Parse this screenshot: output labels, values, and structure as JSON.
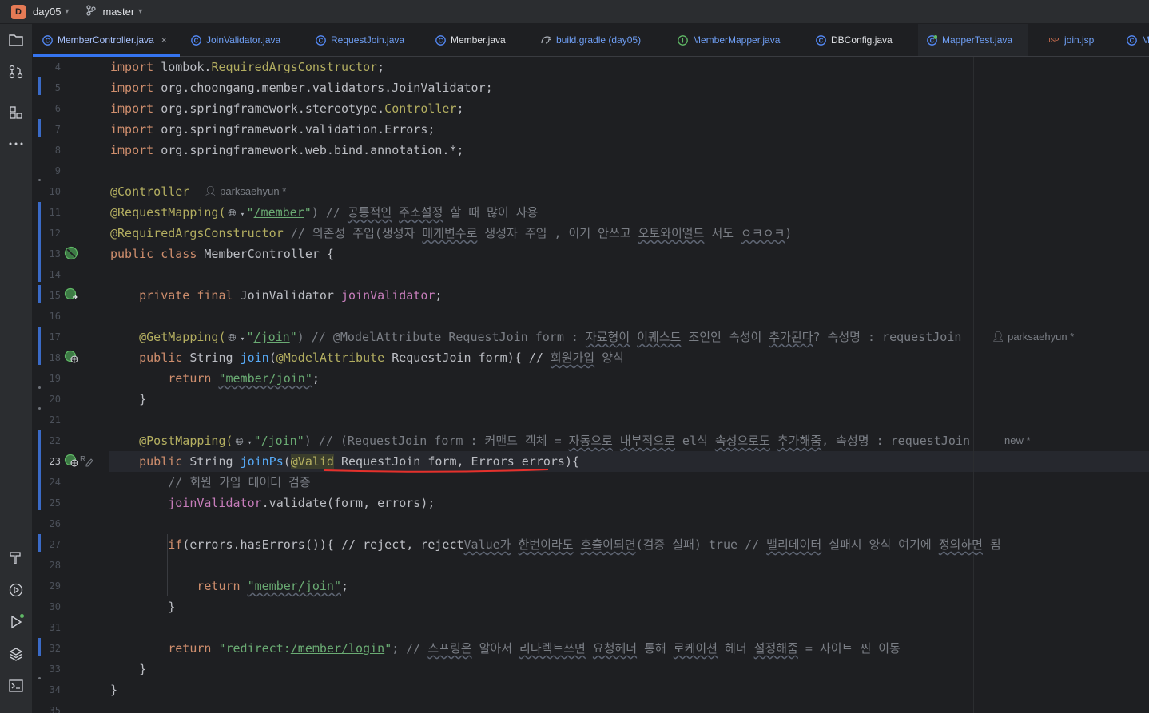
{
  "titlebar": {
    "project_badge": "D",
    "project_name": "day05",
    "branch": "master"
  },
  "toolstrip": {
    "top_tools": [
      "folder-icon",
      "git-commit-icon",
      "structure-icon",
      "more-icon"
    ],
    "bottom_tools": [
      "build-hammer-icon",
      "services-icon",
      "run-icon",
      "layers-icon",
      "terminal-icon"
    ]
  },
  "tabs": [
    {
      "label": "MemberController.java",
      "icon": "class-icon",
      "active": true,
      "close": "×"
    },
    {
      "label": "JoinValidator.java",
      "icon": "class-icon"
    },
    {
      "label": "RequestJoin.java",
      "icon": "class-icon"
    },
    {
      "label": "Member.java",
      "icon": "class-icon"
    },
    {
      "label": "build.gradle (day05)",
      "icon": "gradle-icon"
    },
    {
      "label": "MemberMapper.java",
      "icon": "interface-icon"
    },
    {
      "label": "DBConfig.java",
      "icon": "class-icon"
    },
    {
      "label": "MapperTest.java",
      "icon": "test-class-icon"
    },
    {
      "label": "join.jsp",
      "icon": "jsp-icon"
    },
    {
      "label": "M",
      "icon": "class-icon"
    }
  ],
  "editor": {
    "line_numbers": [
      "4",
      "5",
      "6",
      "7",
      "8",
      "9",
      "10",
      "11",
      "12",
      "13",
      "14",
      "15",
      "16",
      "17",
      "18",
      "19",
      "20",
      "21",
      "22",
      "23",
      "24",
      "25",
      "26",
      "27",
      "28",
      "29",
      "30",
      "31",
      "32",
      "33",
      "34",
      "35"
    ],
    "current_line": "23",
    "authors": {
      "line10": "parksaehyun *",
      "line17": "parksaehyun *",
      "line22": "new *"
    },
    "lines": {
      "l4": [
        "import",
        " lombok.",
        "RequiredArgsConstructor",
        ";"
      ],
      "l5": [
        "import",
        " org.choongang.member.validators.JoinValidator;"
      ],
      "l6": [
        "import",
        " org.springframework.stereotype.",
        "Controller",
        ";"
      ],
      "l7": [
        "import",
        " org.springframework.validation.Errors;"
      ],
      "l8": [
        "import",
        " org.springframework.web.bind.annotation.*;"
      ],
      "l10": [
        "@Controller"
      ],
      "l11": [
        "@RequestMapping(",
        "\"",
        "/member",
        "\"",
        ") // ",
        "공통적인",
        " ",
        "주소설정",
        " 할 때 많이 사용"
      ],
      "l12": [
        "@RequiredArgsConstructor",
        " // 의존성 주입(생성자 ",
        "매개변수로",
        " 생성자 주입 , 이거 안쓰고 ",
        "오토와이얼드",
        " 서도 ",
        "ㅇㅋㅇㅋ",
        ")"
      ],
      "l13": [
        "public class",
        " MemberController {"
      ],
      "l15": [
        "private final",
        " JoinValidator ",
        "joinValidator",
        ";"
      ],
      "l17": [
        "@GetMapping(",
        "\"",
        "/join",
        "\"",
        ") // @ModelAttribute RequestJoin form : ",
        "자료형이",
        " ",
        "이퀘스트",
        " 조인인 속성이 ",
        "추가된다",
        "? 속성명 : requestJoin"
      ],
      "l18": [
        "public",
        " String ",
        "join",
        "(",
        "@ModelAttribute",
        " RequestJoin form){ // ",
        "회원가입",
        " 양식"
      ],
      "l19": [
        "return",
        " ",
        "\"member/join\"",
        ";"
      ],
      "l20": [
        "}"
      ],
      "l22": [
        "@PostMapping(",
        "\"",
        "/join",
        "\"",
        ") // (RequestJoin form : 커맨드 객체 = ",
        "자동으로",
        " ",
        "내부적으로",
        " el식 ",
        "속성으로도",
        " ",
        "추가해줌",
        ", 속성명 : requestJoin"
      ],
      "l23": [
        "public",
        " String ",
        "joinPs",
        "(",
        "@Valid",
        " RequestJoin form, Errors errors){"
      ],
      "l24": [
        "// 회원 가입 데이터 검증"
      ],
      "l25": [
        "joinValidator",
        ".validate(form, errors);"
      ],
      "l27": [
        "if",
        "(errors.hasErrors()){ // reject, reject",
        "Value가",
        " ",
        "한번이라도",
        " ",
        "호출이되면",
        "(검증 실패) true // ",
        "밸리데이터",
        " 실패시 양식 여기에 ",
        "정의하면",
        " 됨"
      ],
      "l29": [
        "return",
        " ",
        "\"member/join\"",
        ";"
      ],
      "l30": [
        "}"
      ],
      "l32": [
        "return",
        " ",
        "\"redirect:",
        "/member/login",
        "\"",
        "; // ",
        "스프링은",
        " 알아서 ",
        "리다렉트쓰면",
        " ",
        "요청헤더",
        " 통해 ",
        "로케이션",
        " 헤더 ",
        "설정해줌",
        " = 사이트 찐 이동"
      ],
      "l33": [
        "}"
      ],
      "l34": [
        "}"
      ]
    }
  },
  "colors": {
    "keyword": "#cf8e6d",
    "annotation": "#b3ae60",
    "string": "#6aab73",
    "comment": "#7a7e85",
    "field": "#c77dbb",
    "method": "#57aaf7",
    "accent": "#3574f0",
    "error_underline": "#e5312c"
  }
}
